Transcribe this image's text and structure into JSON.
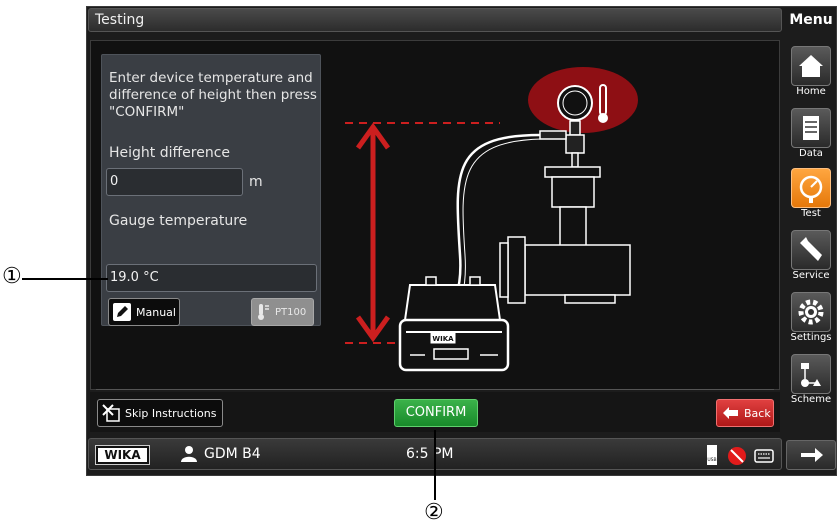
{
  "window": {
    "title": "Testing",
    "menu_title": "Menu"
  },
  "panel": {
    "instruction": "Enter device temperature and difference of height then press \"CONFIRM\"",
    "height_label": "Height difference",
    "height_value": "0",
    "height_unit": "m",
    "temp_label": "Gauge temperature",
    "temp_value": "19.0 °C",
    "manual_label": "Manual",
    "pt100_label": "PT100"
  },
  "illustration": {
    "badge_text": "WIKA"
  },
  "buttons": {
    "skip_label": "Skip Instructions",
    "confirm_label": "CONFIRM",
    "back_label": "Back"
  },
  "status": {
    "brand": "WIKA",
    "user": "GDM B4",
    "time": "6:5",
    "time_suffix": "PM",
    "usb_label": "USB"
  },
  "sidebar": {
    "items": [
      {
        "label": "Home",
        "icon": "home-icon"
      },
      {
        "label": "Data",
        "icon": "data-icon"
      },
      {
        "label": "Test",
        "icon": "gauge-icon",
        "active": true
      },
      {
        "label": "Service",
        "icon": "wrench-icon"
      },
      {
        "label": "Settings",
        "icon": "gear-icon"
      },
      {
        "label": "Scheme",
        "icon": "scheme-icon"
      }
    ]
  },
  "callouts": {
    "one": "①",
    "two": "②"
  },
  "colors": {
    "accent_orange": "#f08c1e",
    "confirm_green": "#2aa53b",
    "back_red": "#d02020",
    "height_red": "#cc1f1f"
  }
}
